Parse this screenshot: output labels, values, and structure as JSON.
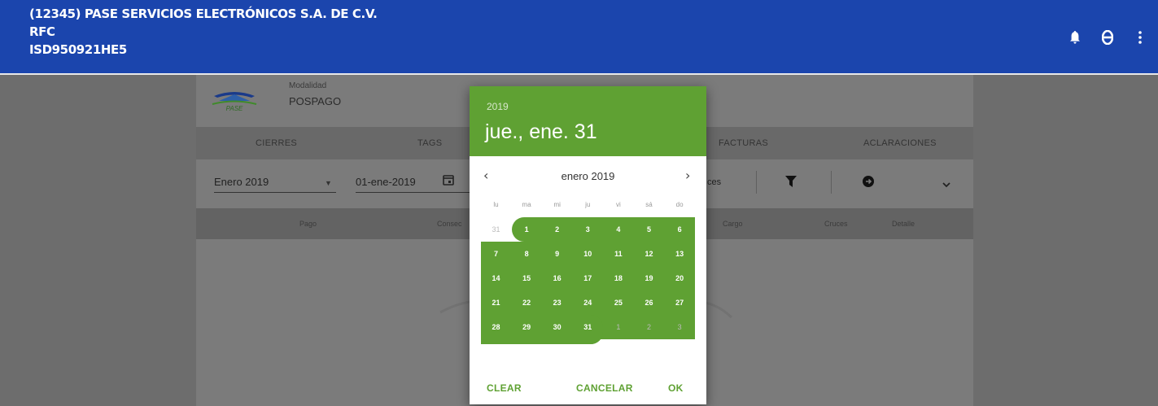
{
  "header": {
    "company": "(12345) PASE SERVICIOS ELECTRÓNICOS S.A. DE C.V.",
    "rfc_label": "RFC",
    "rfc_value": "ISD950921HE5",
    "icons": [
      "bell-icon",
      "account-icon",
      "more-vert-icon"
    ],
    "color": "#1b45ad"
  },
  "account": {
    "logo_text": "PASE",
    "modality_label": "Modalidad",
    "modality_value": "POSPAGO"
  },
  "tabs": [
    "CIERRES",
    "TAGS",
    "FACTURAS",
    "ACLARACIONES"
  ],
  "filters": {
    "period": "Enero 2019",
    "date": "01-ene-2019",
    "partial_label": "ces"
  },
  "table": {
    "headers": [
      "Pago",
      "Consec",
      "Cargo",
      "Cruces",
      "Detalle"
    ]
  },
  "datepicker": {
    "year": "2019",
    "selected_display": "jue., ene. 31",
    "month_label": "enero 2019",
    "weekdays": [
      "lu",
      "ma",
      "mi",
      "ju",
      "vi",
      "sá",
      "do"
    ],
    "weeks": [
      [
        "31",
        "1",
        "2",
        "3",
        "4",
        "5",
        "6"
      ],
      [
        "7",
        "8",
        "9",
        "10",
        "11",
        "12",
        "13"
      ],
      [
        "14",
        "15",
        "16",
        "17",
        "18",
        "19",
        "20"
      ],
      [
        "21",
        "22",
        "23",
        "24",
        "25",
        "26",
        "27"
      ],
      [
        "28",
        "29",
        "30",
        "31",
        "1",
        "2",
        "3"
      ]
    ],
    "range_start": "1",
    "range_end": "31",
    "buttons": {
      "clear": "CLEAR",
      "cancel": "CANCELAR",
      "ok": "OK"
    },
    "accent": "#5fa133"
  }
}
